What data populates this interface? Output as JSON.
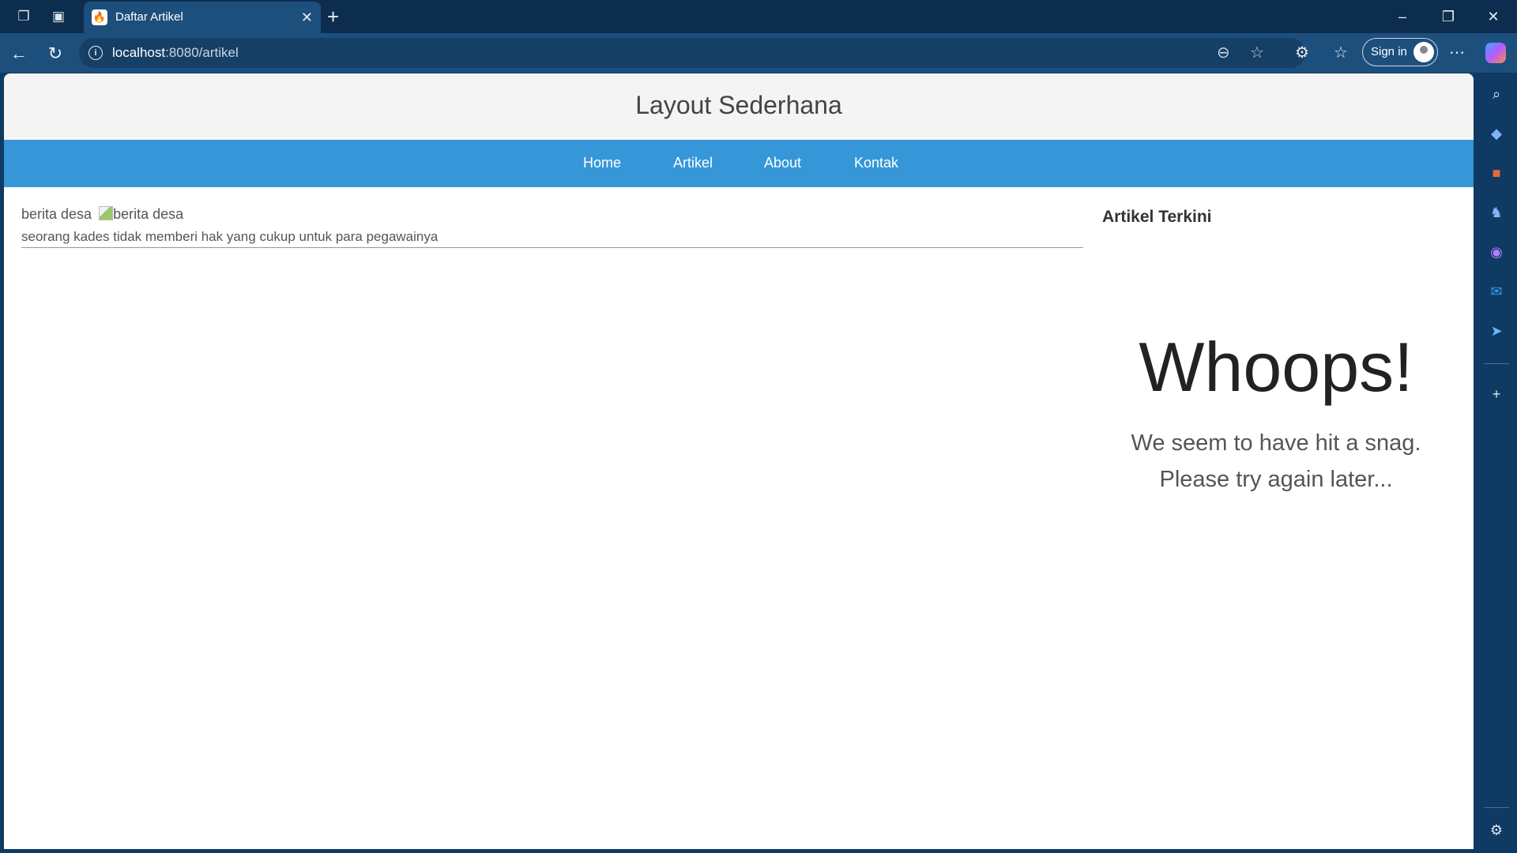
{
  "browser": {
    "tab_title": "Daftar Artikel",
    "url_host": "localhost",
    "url_rest": ":8080/artikel",
    "signin_label": "Sign in"
  },
  "site": {
    "title": "Layout Sederhana",
    "nav": [
      "Home",
      "Artikel",
      "About",
      "Kontak"
    ]
  },
  "article": {
    "title": "berita desa",
    "image_alt": "berita desa",
    "description": "seorang kades tidak memberi hak yang cukup untuk para pegawainya"
  },
  "sidebar": {
    "title": "Artikel Terkini",
    "error_title": "Whoops!",
    "error_line1": "We seem to have hit a snag.",
    "error_line2": "Please try again later..."
  },
  "icons": {
    "workspaces": "workspaces-icon",
    "tab_actions": "tab-actions-icon",
    "search": "search-icon",
    "shopping": "tag-icon",
    "tools": "briefcase-icon",
    "games": "chess-icon",
    "office": "office-icon",
    "outlook": "outlook-icon",
    "send": "send-icon",
    "settings": "gear-icon"
  }
}
